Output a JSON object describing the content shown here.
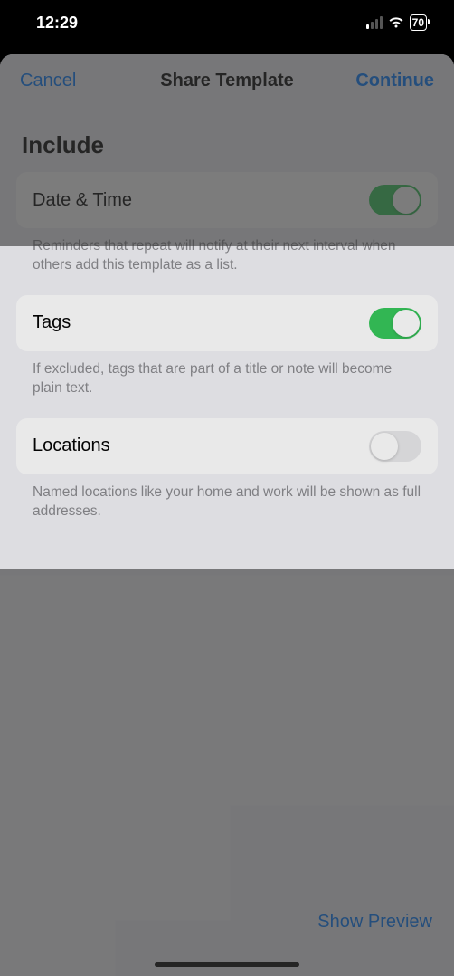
{
  "status": {
    "time": "12:29",
    "battery": "70"
  },
  "nav": {
    "cancel": "Cancel",
    "title": "Share Template",
    "continue": "Continue"
  },
  "section_header": "Include",
  "rows": {
    "datetime": {
      "label": "Date & Time",
      "footer": "Reminders that repeat will notify at their next interval when others add this template as a list.",
      "enabled": true
    },
    "tags": {
      "label": "Tags",
      "footer": "If excluded, tags that are part of a title or note will become plain text.",
      "enabled": true
    },
    "locations": {
      "label": "Locations",
      "footer": "Named locations like your home and work will be shown as full addresses.",
      "enabled": false
    }
  },
  "bottom_link": "Show Preview"
}
